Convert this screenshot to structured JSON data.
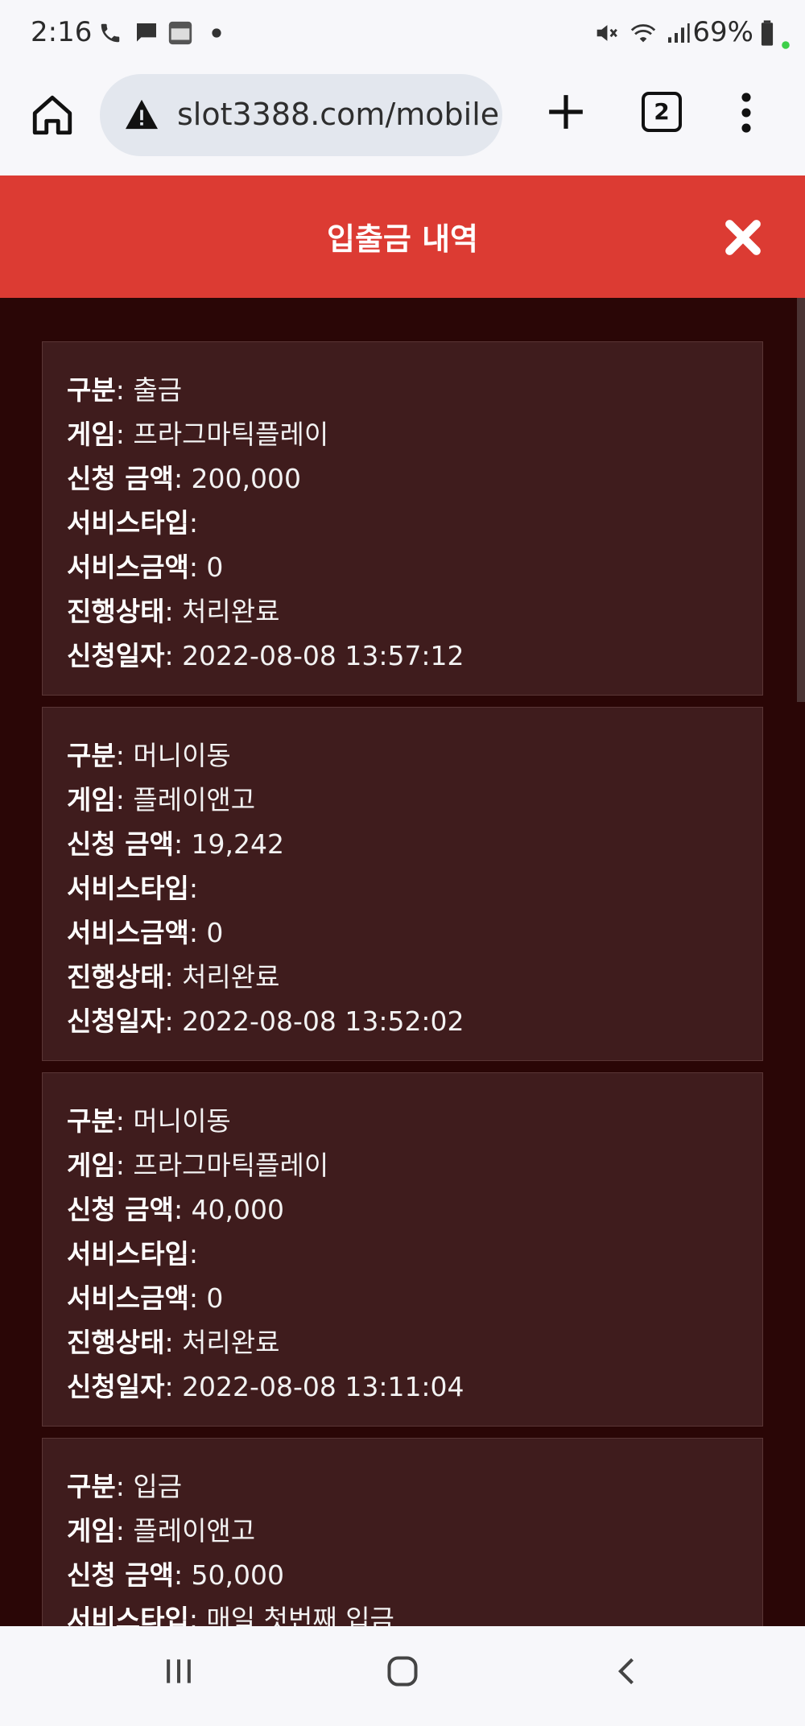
{
  "status_bar": {
    "time": "2:16",
    "battery": "69%",
    "icons": [
      "phone-icon",
      "chat-icon",
      "notification-app-icon",
      "dot-icon",
      "mute-icon",
      "wifi-icon",
      "signal-icon",
      "battery-icon"
    ]
  },
  "browser": {
    "url": "slot3388.com/mobile",
    "tab_count": "2"
  },
  "modal": {
    "title": "입출금 내역"
  },
  "labels": {
    "type": "구분",
    "game": "게임",
    "amount": "신청 금액",
    "service_type": "서비스타입",
    "service_amount": "서비스금액",
    "status": "진행상태",
    "date": "신청일자"
  },
  "records": [
    {
      "type": "출금",
      "game": "프라그마틱플레이",
      "amount": "200,000",
      "service_type": "",
      "service_amount": "0",
      "status": "처리완료",
      "date": "2022-08-08 13:57:12"
    },
    {
      "type": "머니이동",
      "game": "플레이앤고",
      "amount": "19,242",
      "service_type": "",
      "service_amount": "0",
      "status": "처리완료",
      "date": "2022-08-08 13:52:02"
    },
    {
      "type": "머니이동",
      "game": "프라그마틱플레이",
      "amount": "40,000",
      "service_type": "",
      "service_amount": "0",
      "status": "처리완료",
      "date": "2022-08-08 13:11:04"
    },
    {
      "type": "입금",
      "game": "플레이앤고",
      "amount": "50,000",
      "service_type": "매일 첫번째 입금",
      "service_amount": "",
      "status": "",
      "date": ""
    }
  ]
}
